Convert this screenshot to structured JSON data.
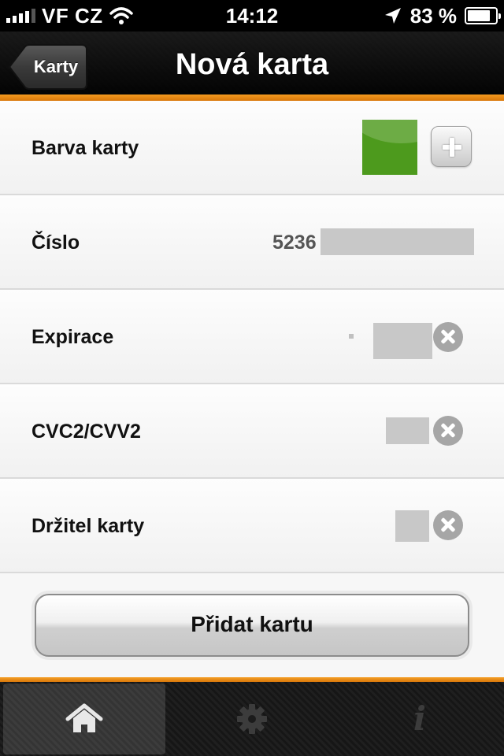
{
  "status_bar": {
    "carrier": "VF CZ",
    "time": "14:12",
    "battery_percent": "83 %",
    "battery_level": 0.83,
    "signal_bars": 4,
    "icons": [
      "signal-icon",
      "wifi-icon",
      "location-arrow-icon",
      "battery-icon"
    ]
  },
  "nav": {
    "title": "Nová karta",
    "back_label": "Karty"
  },
  "form": {
    "color_row": {
      "label": "Barva karty",
      "selected_color": "#4d9a1d"
    },
    "number_row": {
      "label": "Číslo",
      "value_prefix": "5236"
    },
    "expiry_row": {
      "label": "Expirace"
    },
    "cvc_row": {
      "label": "CVC2/CVV2"
    },
    "holder_row": {
      "label": "Držitel karty"
    },
    "submit_label": "Přidat kartu"
  },
  "tabs": [
    {
      "icon": "home-icon",
      "active": true
    },
    {
      "icon": "gear-icon",
      "active": false
    },
    {
      "icon": "info-icon",
      "active": false
    }
  ],
  "colors": {
    "accent": "#f39a1e",
    "nav_background": "#1e1e1e",
    "card_color": "#4d9a1d"
  }
}
